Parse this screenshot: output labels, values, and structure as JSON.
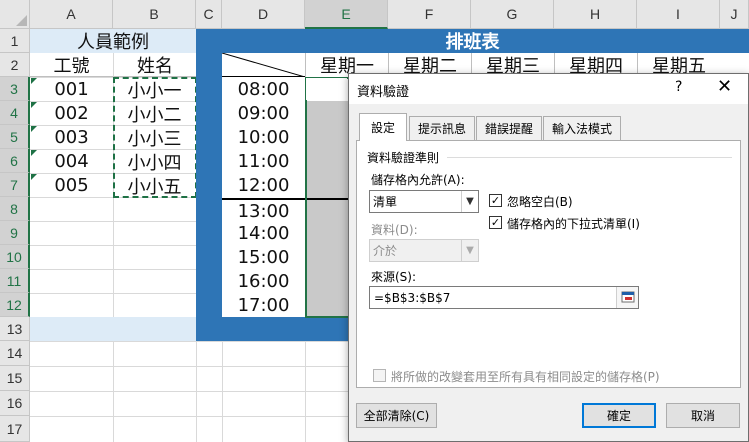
{
  "sheet": {
    "columns": [
      "A",
      "B",
      "C",
      "D",
      "E",
      "F",
      "G",
      "H",
      "I",
      "J"
    ],
    "rows": [
      "1",
      "2",
      "3",
      "4",
      "5",
      "6",
      "7",
      "8",
      "9",
      "10",
      "11",
      "12",
      "13",
      "14",
      "15",
      "16",
      "17"
    ],
    "people_title": "人員範例",
    "shift_title": "排班表",
    "col_id_header": "工號",
    "col_name_header": "姓名",
    "ids": [
      "001",
      "002",
      "003",
      "004",
      "005"
    ],
    "names": [
      "小小一",
      "小小二",
      "小小三",
      "小小四",
      "小小五"
    ],
    "weekdays": [
      "星期一",
      "星期二",
      "星期三",
      "星期四",
      "星期五"
    ],
    "times": [
      "08:00",
      "09:00",
      "10:00",
      "11:00",
      "12:00",
      "13:00",
      "14:00",
      "15:00",
      "16:00",
      "17:00"
    ],
    "colors": {
      "shift_blue": "#2e75b6",
      "people_header_bg": "#ddebf7",
      "excel_green": "#217346",
      "shaded": "#c9c9c9"
    }
  },
  "dialog": {
    "title": "資料驗證",
    "help": "?",
    "close": "✕",
    "tabs": [
      "設定",
      "提示訊息",
      "錯誤提醒",
      "輸入法模式"
    ],
    "section_label": "資料驗證準則",
    "allow_label": "儲存格內允許(A):",
    "allow_value": "清單",
    "ignore_blank_label": "忽略空白(B)",
    "ignore_blank_checked": true,
    "in_cell_dropdown_label": "儲存格內的下拉式清單(I)",
    "in_cell_dropdown_checked": true,
    "data_label": "資料(D):",
    "data_value": "介於",
    "source_label": "來源(S):",
    "source_value": "=$B$3:$B$7",
    "apply_all_label": "將所做的改變套用至所有具有相同設定的儲存格(P)",
    "clear_all_button": "全部清除(C)",
    "ok_button": "確定",
    "cancel_button": "取消",
    "check_mark": "✓",
    "dropdown_arrow": "▼"
  }
}
